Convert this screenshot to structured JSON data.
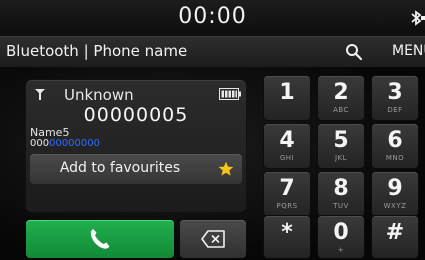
{
  "status": {
    "clock": "00:00"
  },
  "header": {
    "title": "Bluetooth | Phone name",
    "menu_label": "MENU"
  },
  "call": {
    "caller_name": "Unknown",
    "caller_number": "00000005",
    "contact_name": "Name5",
    "contact_number_prefix": "000",
    "contact_number_highlight": "00000000",
    "highlight_color": "#2f6bff",
    "favourite_label": "Add to favourites"
  },
  "keypad": {
    "keys": [
      {
        "digit": "1",
        "letters": ""
      },
      {
        "digit": "2",
        "letters": "ABC"
      },
      {
        "digit": "3",
        "letters": "DEF"
      },
      {
        "digit": "4",
        "letters": "GHI"
      },
      {
        "digit": "5",
        "letters": "JKL"
      },
      {
        "digit": "6",
        "letters": "MNO"
      },
      {
        "digit": "7",
        "letters": "PQRS"
      },
      {
        "digit": "8",
        "letters": "TUV"
      },
      {
        "digit": "9",
        "letters": "WXYZ"
      },
      {
        "digit": "*",
        "letters": ""
      },
      {
        "digit": "0",
        "letters": "+"
      },
      {
        "digit": "#",
        "letters": ""
      }
    ]
  },
  "icons": {
    "bluetooth": "bluetooth-icon",
    "search": "search-icon",
    "signal": "signal-icon",
    "battery": "battery-icon",
    "star": "star-icon",
    "call": "phone-call-icon",
    "backspace": "backspace-icon"
  },
  "colors": {
    "call_button": "#1a9e44",
    "star": "#f5c518",
    "accent_blue": "#2f6bff"
  }
}
